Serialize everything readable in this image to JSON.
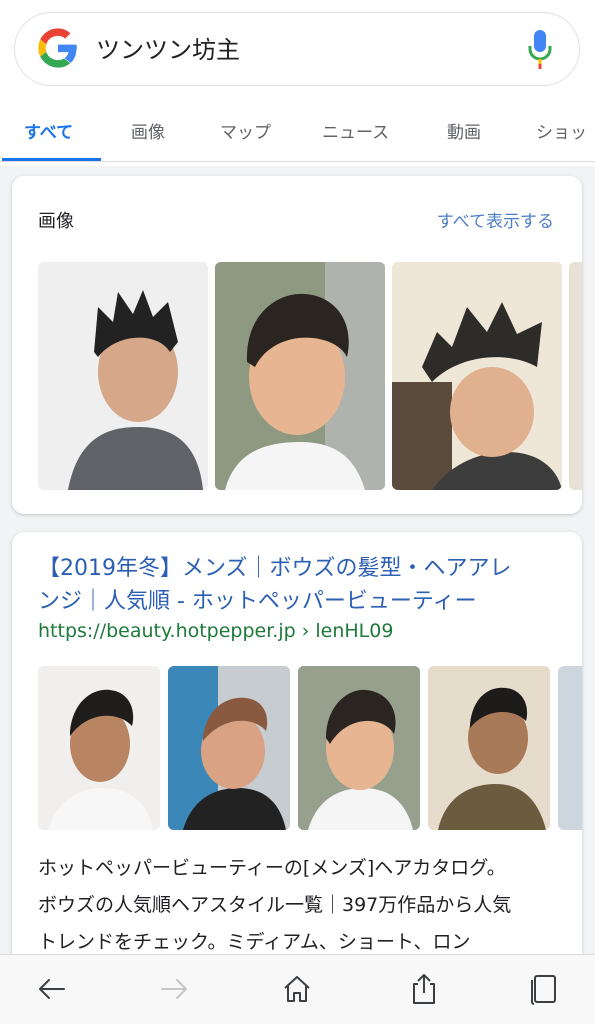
{
  "search": {
    "query": "ツンツン坊主"
  },
  "tabs": [
    {
      "label": "すべて",
      "active": true
    },
    {
      "label": "画像"
    },
    {
      "label": "マップ"
    },
    {
      "label": "ニュース"
    },
    {
      "label": "動画"
    },
    {
      "label": "ショッ"
    }
  ],
  "images_card": {
    "title": "画像",
    "show_all": "すべて表示する"
  },
  "result": {
    "title_line1": "【2019年冬】メンズ｜ボウズの髪型・ヘアアレ",
    "title_line2": "ンジ｜人気順 - ホットペッパービューティー",
    "url": "https://beauty.hotpepper.jp › lenHL09",
    "snippet_line1": "ホットペッパービューティーの[メンズ]ヘアカタログ。",
    "snippet_line2": "ボウズの人気順ヘアスタイル一覧｜397万作品から人気",
    "snippet_line3": "トレンドをチェック。ミディアム、ショート、ロン"
  },
  "bottom_bar": {
    "icons": [
      "back-arrow-icon",
      "forward-arrow-icon",
      "home-icon",
      "share-icon",
      "tabs-icon"
    ]
  },
  "colors": {
    "accent": "#1a73e8",
    "link": "#2b5fb3",
    "url": "#1e7a3a"
  }
}
